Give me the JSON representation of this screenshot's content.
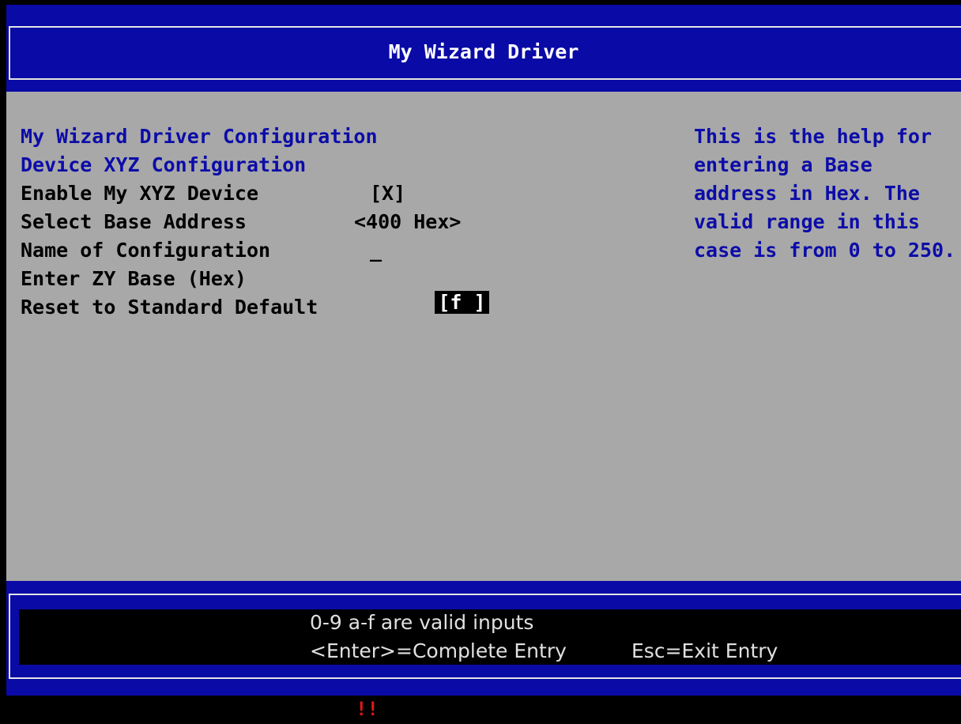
{
  "header": {
    "title": "My Wizard Driver"
  },
  "form": {
    "section_title": "My Wizard Driver Configuration",
    "subsection_title": "Device XYZ Configuration",
    "items": [
      {
        "label": "Enable My XYZ Device",
        "value": "[X]"
      },
      {
        "label": "Select Base Address",
        "value": "<400 Hex>"
      },
      {
        "label": "Name of Configuration",
        "value": "_"
      },
      {
        "label": "Enter ZY Base (Hex)",
        "value": "[f ]"
      },
      {
        "label": "Reset to Standard Default",
        "value": ""
      }
    ]
  },
  "help": {
    "lines": [
      "This is the help for",
      "entering a Base",
      "address in Hex. The",
      "valid range in this",
      "case is from 0 to 250."
    ]
  },
  "footer": {
    "line1": "0-9 a-f are valid inputs",
    "enter_hint": "<Enter>=Complete Entry",
    "esc_hint": "Esc=Exit Entry"
  },
  "status": {
    "alert": "!!"
  },
  "colors": {
    "header_bg": "#0a0aa6",
    "body_bg": "#a8a8a8",
    "accent_text": "#0c0ca8",
    "alert": "#e01818"
  }
}
